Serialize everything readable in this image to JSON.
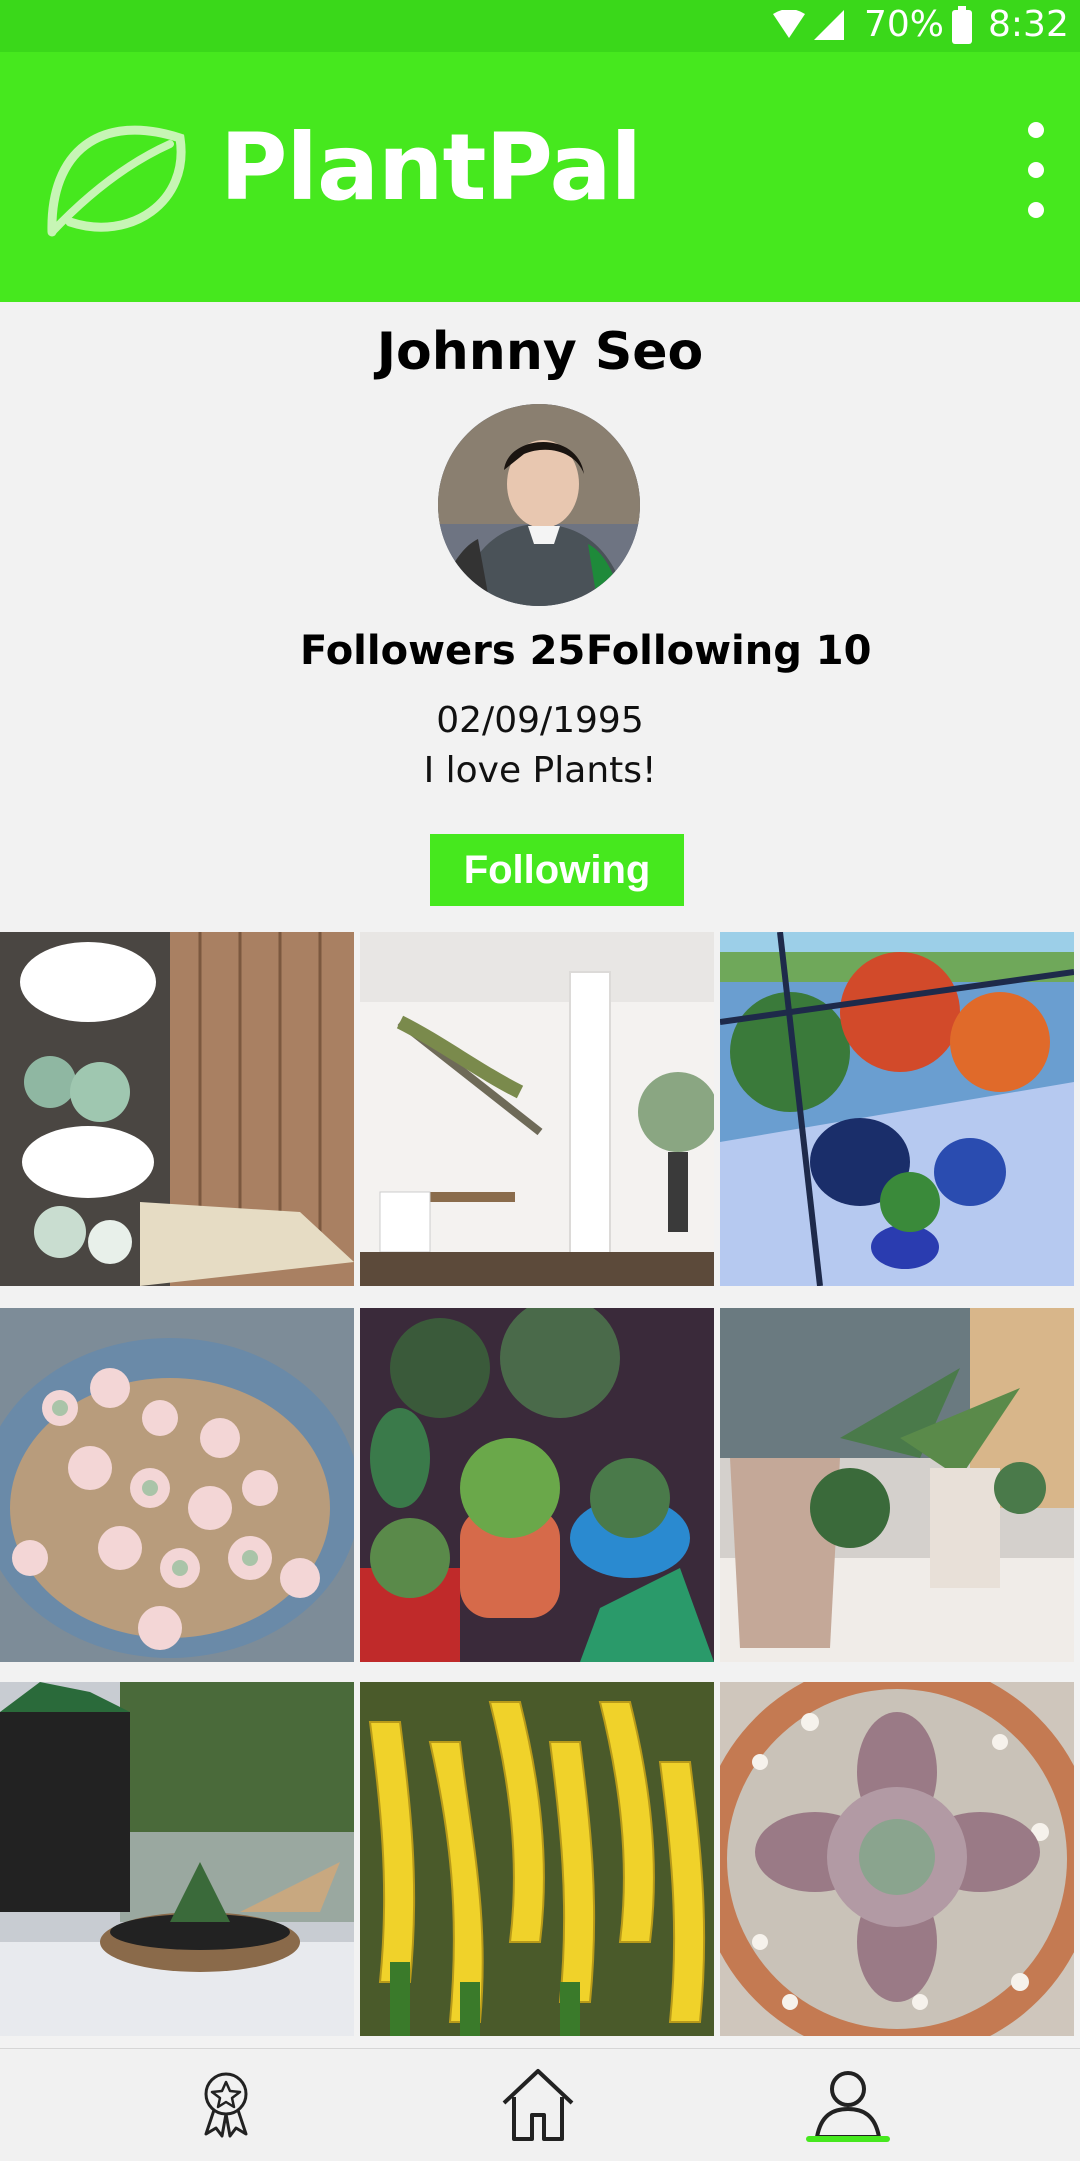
{
  "status_bar": {
    "battery": "70%",
    "time": "8:32",
    "icons": [
      "wifi-icon",
      "signal-icon",
      "battery-icon"
    ]
  },
  "app_bar": {
    "title": "PlantPal",
    "logo_icon": "leaf-icon",
    "menu_icon": "more-vert-icon",
    "background": "#46e81e"
  },
  "profile": {
    "name": "Johnny Seo",
    "followers_label": "Followers 25",
    "following_label": "Following 10",
    "birthdate": "02/09/1995",
    "bio": "I love Plants!",
    "follow_button": "Following"
  },
  "bottom_nav": {
    "items": [
      {
        "icon": "award-ribbon-icon",
        "active": false
      },
      {
        "icon": "home-icon",
        "active": false
      },
      {
        "icon": "profile-icon",
        "active": true
      }
    ],
    "accent": "#46e81e"
  }
}
